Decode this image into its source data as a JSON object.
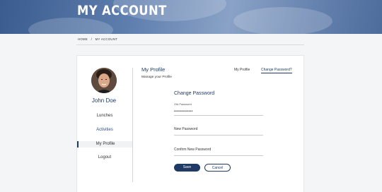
{
  "hero": {
    "title": "MY ACCOUNT"
  },
  "breadcrumb": {
    "home": "HOME",
    "sep": "/",
    "current": "MY ACCOUNT"
  },
  "user": {
    "name": "John Doe"
  },
  "sidebar": {
    "items": [
      {
        "label": "Lunches"
      },
      {
        "label": "Activities"
      },
      {
        "label": "My Profile"
      },
      {
        "label": "Logout"
      }
    ]
  },
  "main": {
    "title": "My Profile",
    "subtitle": "Manage your Profile",
    "tabs": [
      {
        "label": "My Profile"
      },
      {
        "label": "Change Password?"
      }
    ]
  },
  "form": {
    "title": "Change Password",
    "old_password_label": "Old Password",
    "old_password_value": "•••••••••••••",
    "new_password_label": "New Password",
    "confirm_password_label": "Confirm New Password",
    "save_label": "Save",
    "cancel_label": "Cancel"
  },
  "colors": {
    "primary": "#1f3a64",
    "link": "#2a4e86"
  }
}
